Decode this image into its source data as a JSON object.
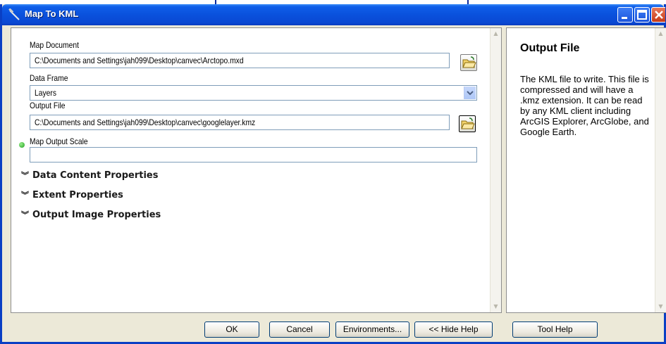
{
  "window": {
    "title": "Map To KML",
    "controls": {
      "minimize": "minimize",
      "maximize": "maximize",
      "close": "close"
    }
  },
  "form": {
    "map_document": {
      "label": "Map Document",
      "value": "C:\\Documents and Settings\\jah099\\Desktop\\canvec\\Arctopo.mxd"
    },
    "data_frame": {
      "label": "Data Frame",
      "value": "Layers"
    },
    "output_file": {
      "label": "Output File",
      "value": "C:\\Documents and Settings\\jah099\\Desktop\\canvec\\googlelayer.kmz"
    },
    "map_output_scale": {
      "label": "Map Output Scale",
      "value": ""
    },
    "sections": [
      {
        "label": "Data Content Properties"
      },
      {
        "label": "Extent Properties"
      },
      {
        "label": "Output Image Properties"
      }
    ]
  },
  "help": {
    "title": "Output File",
    "body": "The KML file to write. This file is compressed and will have a .kmz extension. It can be read by any KML client including ArcGIS Explorer, ArcGlobe, and Google Earth."
  },
  "buttons": {
    "ok": "OK",
    "cancel": "Cancel",
    "environments": "Environments...",
    "hide_help": "<< Hide Help",
    "tool_help": "Tool Help"
  },
  "colors": {
    "titlebar": "#0a51dd",
    "dialog_bg": "#ece9d8",
    "field_border": "#7f9db9",
    "required_dot": "#1f9d1f"
  }
}
